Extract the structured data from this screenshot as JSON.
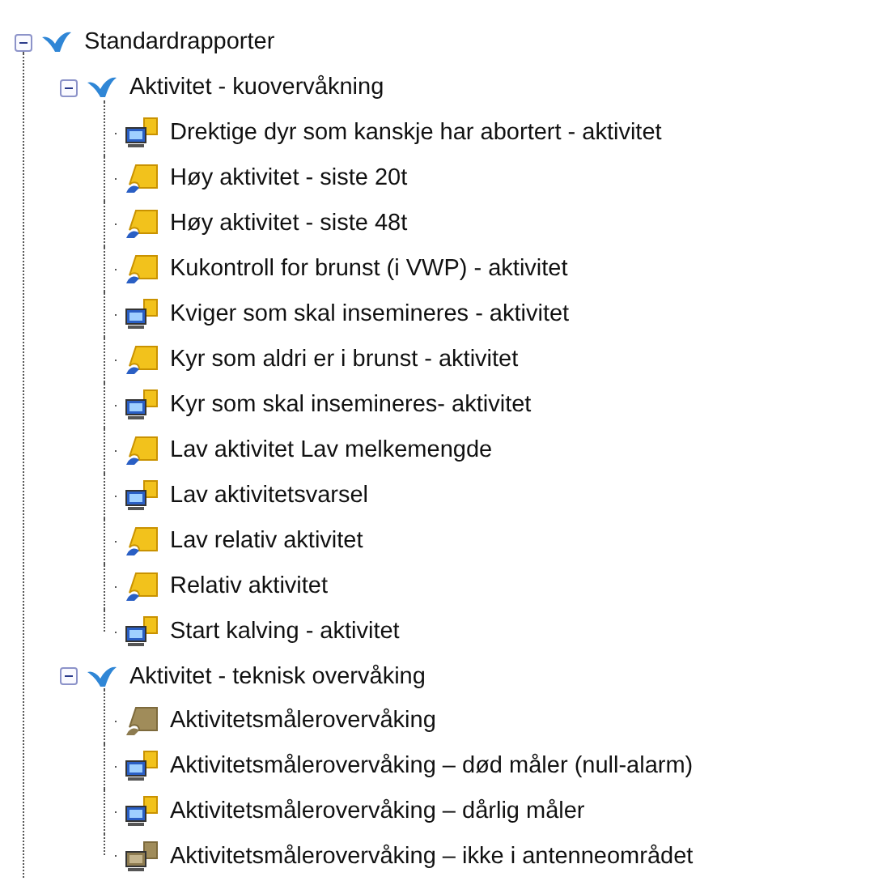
{
  "tree": {
    "label": "Standardrapporter",
    "expanded": true,
    "children": [
      {
        "label": "Aktivitet - kuovervåkning",
        "expanded": true,
        "children": [
          {
            "label": "Drektige dyr som kanskje har abortert - aktivitet",
            "kind": "computer",
            "dimmed": false
          },
          {
            "label": "Høy aktivitet - siste 20t",
            "kind": "report",
            "dimmed": false
          },
          {
            "label": "Høy aktivitet - siste 48t",
            "kind": "report",
            "dimmed": false
          },
          {
            "label": "Kukontroll for brunst (i VWP) - aktivitet",
            "kind": "report",
            "dimmed": false
          },
          {
            "label": "Kviger som skal insemineres - aktivitet",
            "kind": "computer",
            "dimmed": false
          },
          {
            "label": "Kyr som aldri er i brunst - aktivitet",
            "kind": "report",
            "dimmed": false
          },
          {
            "label": "Kyr som skal insemineres- aktivitet",
            "kind": "computer",
            "dimmed": false
          },
          {
            "label": "Lav aktivitet Lav melkemengde",
            "kind": "report",
            "dimmed": false
          },
          {
            "label": "Lav aktivitetsvarsel",
            "kind": "computer",
            "dimmed": false
          },
          {
            "label": "Lav relativ aktivitet",
            "kind": "report",
            "dimmed": false
          },
          {
            "label": "Relativ aktivitet",
            "kind": "report",
            "dimmed": false
          },
          {
            "label": "Start kalving - aktivitet",
            "kind": "computer",
            "dimmed": false
          }
        ]
      },
      {
        "label": "Aktivitet - teknisk overvåking",
        "expanded": true,
        "children": [
          {
            "label": "Aktivitetsmålerovervåking",
            "kind": "report",
            "dimmed": true
          },
          {
            "label": "Aktivitetsmålerovervåking – død måler (null-alarm)",
            "kind": "computer",
            "dimmed": false
          },
          {
            "label": "Aktivitetsmålerovervåking – dårlig måler",
            "kind": "computer",
            "dimmed": false
          },
          {
            "label": "Aktivitetsmålerovervåking – ikke i antenneområdet",
            "kind": "computer",
            "dimmed": true
          }
        ]
      }
    ]
  }
}
